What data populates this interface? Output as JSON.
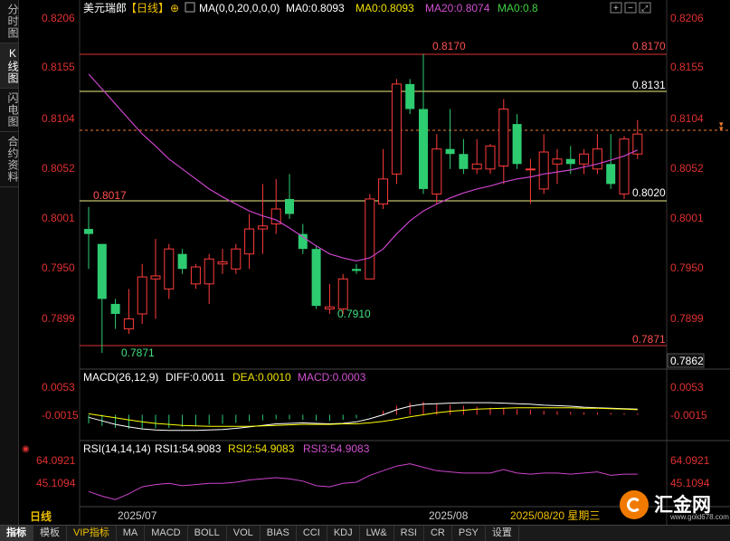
{
  "left_tabs": [
    "分时图",
    "K线图",
    "闪电图",
    "合约资料"
  ],
  "left_tab_active": 1,
  "header": {
    "title": "美元瑞郎",
    "period": "【日线】",
    "ma_params": "MA(0,0,20,0,0,0)",
    "ma0": "MA0:0.8093",
    "ma0b": "MA0:0.8093",
    "ma20": "MA20:0.8074",
    "ma0c": "MA0:0.8"
  },
  "macd_header": {
    "name": "MACD(26,12,9)",
    "diff": "DIFF:0.0011",
    "dea": "DEA:0.0010",
    "macd": "MACD:0.0003"
  },
  "rsi_header": {
    "name": "RSI(14,14,14)",
    "rsi1": "RSI1:54.9083",
    "rsi2": "RSI2:54.9083",
    "rsi3": "RSI3:54.9083"
  },
  "period_label": "日线",
  "x_labels": [
    "2025/07",
    "2025/08"
  ],
  "date_label": "2025/08/20 星期三",
  "price_axis": [
    "0.8206",
    "0.8155",
    "0.8104",
    "0.8052",
    "0.8001",
    "0.7950",
    "0.7899"
  ],
  "price_axis_right": [
    "0.8206",
    "0.8155",
    "0.8104",
    "0.8052",
    "0.8001",
    "0.7950",
    "0.7899"
  ],
  "current_price": "0.7862",
  "macd_axis": [
    "0.0053",
    "-0.0015"
  ],
  "rsi_axis": [
    "64.0921",
    "45.1094"
  ],
  "annotations": {
    "high": "0.8170",
    "high_right": "0.8170",
    "line_8131": "0.8131",
    "line_8017": "0.8017",
    "line_8020": "0.8020",
    "low_7910": "0.7910",
    "low_7871": "0.7871",
    "low_right": "0.7871"
  },
  "bottom_tabs": [
    "指标",
    "模板",
    "VIP指标",
    "MA",
    "MACD",
    "BOLL",
    "VOL",
    "BIAS",
    "CCI",
    "KDJ",
    "LW&",
    "RSI",
    "CR",
    "PSY",
    "设置"
  ],
  "bottom_tab_active": 0,
  "logo": {
    "name": "汇金网",
    "site": "www.gold678.com"
  },
  "colors": {
    "up": "#ff3b3b",
    "down": "#2ecc71",
    "ma": "#cc44cc",
    "macd_diff": "#ffffff",
    "macd_dea": "#ffff00",
    "rsi": "#cc44cc"
  },
  "chart_data": {
    "type": "candlestick",
    "price_range": [
      0.7862,
      0.8206
    ],
    "candles": [
      {
        "o": 0.7995,
        "h": 0.8017,
        "l": 0.7955,
        "c": 0.799
      },
      {
        "o": 0.798,
        "h": 0.798,
        "l": 0.7871,
        "c": 0.7925
      },
      {
        "o": 0.792,
        "h": 0.7925,
        "l": 0.7895,
        "c": 0.791
      },
      {
        "o": 0.7895,
        "h": 0.7935,
        "l": 0.789,
        "c": 0.7905
      },
      {
        "o": 0.791,
        "h": 0.796,
        "l": 0.79,
        "c": 0.7947
      },
      {
        "o": 0.7945,
        "h": 0.7985,
        "l": 0.7905,
        "c": 0.7948
      },
      {
        "o": 0.7935,
        "h": 0.798,
        "l": 0.7925,
        "c": 0.7975
      },
      {
        "o": 0.797,
        "h": 0.7975,
        "l": 0.795,
        "c": 0.7955
      },
      {
        "o": 0.794,
        "h": 0.796,
        "l": 0.7935,
        "c": 0.7957
      },
      {
        "o": 0.794,
        "h": 0.797,
        "l": 0.792,
        "c": 0.7965
      },
      {
        "o": 0.796,
        "h": 0.7975,
        "l": 0.795,
        "c": 0.7962
      },
      {
        "o": 0.7955,
        "h": 0.798,
        "l": 0.795,
        "c": 0.7975
      },
      {
        "o": 0.797,
        "h": 0.801,
        "l": 0.7955,
        "c": 0.7995
      },
      {
        "o": 0.7995,
        "h": 0.804,
        "l": 0.797,
        "c": 0.7998
      },
      {
        "o": 0.8,
        "h": 0.8045,
        "l": 0.799,
        "c": 0.8015
      },
      {
        "o": 0.8025,
        "h": 0.805,
        "l": 0.8005,
        "c": 0.801
      },
      {
        "o": 0.799,
        "h": 0.8,
        "l": 0.797,
        "c": 0.7975
      },
      {
        "o": 0.7975,
        "h": 0.7978,
        "l": 0.7915,
        "c": 0.7918
      },
      {
        "o": 0.7915,
        "h": 0.794,
        "l": 0.791,
        "c": 0.7917
      },
      {
        "o": 0.7915,
        "h": 0.795,
        "l": 0.791,
        "c": 0.7945
      },
      {
        "o": 0.7955,
        "h": 0.796,
        "l": 0.795,
        "c": 0.7953
      },
      {
        "o": 0.7945,
        "h": 0.803,
        "l": 0.7945,
        "c": 0.8025
      },
      {
        "o": 0.802,
        "h": 0.8075,
        "l": 0.8015,
        "c": 0.8045
      },
      {
        "o": 0.805,
        "h": 0.8145,
        "l": 0.804,
        "c": 0.814
      },
      {
        "o": 0.814,
        "h": 0.8145,
        "l": 0.811,
        "c": 0.8115
      },
      {
        "o": 0.8115,
        "h": 0.817,
        "l": 0.803,
        "c": 0.8035
      },
      {
        "o": 0.803,
        "h": 0.809,
        "l": 0.802,
        "c": 0.8075
      },
      {
        "o": 0.8075,
        "h": 0.8115,
        "l": 0.8055,
        "c": 0.807
      },
      {
        "o": 0.807,
        "h": 0.8085,
        "l": 0.805,
        "c": 0.8055
      },
      {
        "o": 0.8055,
        "h": 0.8085,
        "l": 0.805,
        "c": 0.806
      },
      {
        "o": 0.8055,
        "h": 0.808,
        "l": 0.805,
        "c": 0.8078
      },
      {
        "o": 0.8058,
        "h": 0.8125,
        "l": 0.804,
        "c": 0.8115
      },
      {
        "o": 0.81,
        "h": 0.811,
        "l": 0.8055,
        "c": 0.806
      },
      {
        "o": 0.8055,
        "h": 0.8065,
        "l": 0.802,
        "c": 0.8055
      },
      {
        "o": 0.8035,
        "h": 0.809,
        "l": 0.803,
        "c": 0.8072
      },
      {
        "o": 0.806,
        "h": 0.8075,
        "l": 0.804,
        "c": 0.8065
      },
      {
        "o": 0.8065,
        "h": 0.8078,
        "l": 0.805,
        "c": 0.806
      },
      {
        "o": 0.806,
        "h": 0.8075,
        "l": 0.805,
        "c": 0.807
      },
      {
        "o": 0.8055,
        "h": 0.809,
        "l": 0.805,
        "c": 0.8075
      },
      {
        "o": 0.806,
        "h": 0.809,
        "l": 0.8035,
        "c": 0.804
      },
      {
        "o": 0.803,
        "h": 0.8088,
        "l": 0.8025,
        "c": 0.8085
      },
      {
        "o": 0.807,
        "h": 0.8104,
        "l": 0.8065,
        "c": 0.809
      }
    ],
    "ma20": [
      0.815,
      0.8135,
      0.812,
      0.8105,
      0.809,
      0.8078,
      0.8065,
      0.8055,
      0.8045,
      0.8035,
      0.8027,
      0.802,
      0.8013,
      0.8008,
      0.8004,
      0.7996,
      0.7987,
      0.7978,
      0.797,
      0.7966,
      0.7963,
      0.7966,
      0.7975,
      0.799,
      0.8003,
      0.8013,
      0.802,
      0.8026,
      0.8031,
      0.8035,
      0.8038,
      0.8042,
      0.8045,
      0.8047,
      0.805,
      0.8052,
      0.8054,
      0.8057,
      0.806,
      0.8064,
      0.8068,
      0.8074
    ],
    "macd_hist": [
      -0.0017,
      -0.0022,
      -0.0026,
      -0.0028,
      -0.0028,
      -0.0027,
      -0.0026,
      -0.0024,
      -0.0022,
      -0.002,
      -0.0018,
      -0.0016,
      -0.0013,
      -0.0011,
      -0.0009,
      -0.0009,
      -0.001,
      -0.0012,
      -0.0012,
      -0.001,
      -0.0007,
      -0.0001,
      0.0008,
      0.0018,
      0.0024,
      0.0026,
      0.0022,
      0.002,
      0.0018,
      0.0016,
      0.0014,
      0.0013,
      0.0011,
      0.001,
      0.0008,
      0.0007,
      0.0006,
      0.0005,
      0.0005,
      0.0004,
      0.0003,
      0.0003
    ],
    "macd_diff": [
      -0.0005,
      -0.0012,
      -0.0019,
      -0.0024,
      -0.0028,
      -0.003,
      -0.0031,
      -0.0031,
      -0.0031,
      -0.003,
      -0.0029,
      -0.0027,
      -0.0024,
      -0.0021,
      -0.0018,
      -0.0017,
      -0.0016,
      -0.0017,
      -0.0018,
      -0.0017,
      -0.0014,
      -0.0008,
      0.0,
      0.001,
      0.0017,
      0.0021,
      0.0022,
      0.0023,
      0.0024,
      0.0024,
      0.0024,
      0.0023,
      0.0022,
      0.0021,
      0.0019,
      0.0018,
      0.0017,
      0.0015,
      0.0014,
      0.0013,
      0.0012,
      0.0011
    ],
    "macd_dea": [
      0.0002,
      -0.0002,
      -0.0006,
      -0.001,
      -0.0014,
      -0.0017,
      -0.0019,
      -0.0021,
      -0.0022,
      -0.0023,
      -0.0023,
      -0.0023,
      -0.0023,
      -0.0022,
      -0.0021,
      -0.002,
      -0.0019,
      -0.0019,
      -0.0019,
      -0.0018,
      -0.0018,
      -0.0016,
      -0.0013,
      -0.0009,
      -0.0004,
      0.0,
      0.0004,
      0.0007,
      0.0009,
      0.0011,
      0.0012,
      0.0013,
      0.0014,
      0.0014,
      0.0014,
      0.0014,
      0.0014,
      0.0013,
      0.0013,
      0.0012,
      0.0011,
      0.001
    ],
    "macd_range": [
      -0.0035,
      0.006
    ],
    "rsi": [
      40,
      36,
      33,
      38,
      44,
      46,
      47,
      45,
      46,
      47,
      47,
      48,
      50,
      51,
      52,
      51,
      49,
      45,
      44,
      47,
      48,
      54,
      58,
      62,
      64,
      61,
      58,
      57,
      56,
      56,
      56,
      59,
      56,
      55,
      56,
      56,
      55,
      56,
      57,
      54,
      55,
      55
    ],
    "rsi_range": [
      30,
      70
    ]
  }
}
